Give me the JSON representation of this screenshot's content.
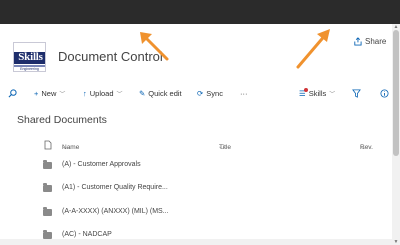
{
  "header": {
    "logo_text": "Skills",
    "logo_subtext": "Engineering",
    "site_title": "Document Control",
    "share_label": "Share"
  },
  "commandbar": {
    "new_label": "New",
    "upload_label": "Upload",
    "quickedit_label": "Quick edit",
    "sync_label": "Sync",
    "more_label": "···",
    "view_label": "Skills"
  },
  "library": {
    "title": "Shared Documents",
    "columns": {
      "name": "Name",
      "title": "Title",
      "rev": "Rev."
    },
    "rows": [
      {
        "name": "(A) - Customer Approvals"
      },
      {
        "name": "(A1) - Customer Quality Require..."
      },
      {
        "name": "(A-A-XXXX) (ANXXX) (MIL) (MS..."
      },
      {
        "name": "(AC) - NADCAP"
      }
    ]
  },
  "colors": {
    "suitebar": "#2b2b2b",
    "accent": "#0a64b4",
    "annotation_arrow": "#f0922e"
  }
}
